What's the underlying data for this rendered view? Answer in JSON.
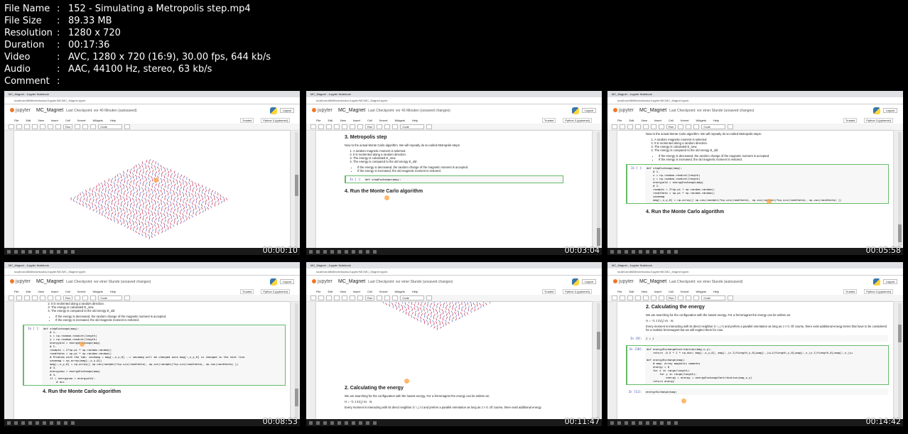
{
  "file_info": [
    {
      "key": "File Name",
      "value": "152 - Simulating a Metropolis step.mp4"
    },
    {
      "key": "File Size",
      "value": "89.33 MB"
    },
    {
      "key": "Resolution",
      "value": "1280 x 720"
    },
    {
      "key": "Duration",
      "value": "00:17:36"
    },
    {
      "key": "Video",
      "value": "AVC, 1280 x 720 (16:9), 30.00 fps, 644 kb/s"
    },
    {
      "key": "Audio",
      "value": "AAC, 44100 Hz, stereo, 63 kb/s"
    },
    {
      "key": "Comment",
      "value": ""
    }
  ],
  "colon": ":",
  "common": {
    "tab_title": "MC_Magnet - Jupyter Notebook",
    "url": "localhost:8888/notebooks/Jupyter/MC/MC_Magnet.ipynb",
    "logo_text": "jupyter",
    "notebook_name": "MC_Magnet",
    "logout": "Logout",
    "trusted": "Trusted",
    "kernel": "Python 3 (pykernel)",
    "menu": [
      "File",
      "Edit",
      "View",
      "Insert",
      "Cell",
      "Kernel",
      "Widgets",
      "Help"
    ],
    "run": "Run",
    "cell_type": "Code"
  },
  "thumbnails": [
    {
      "timestamp": "00:00:10",
      "checkpoint": "Last Checkpoint: vor 40 Minuten  (autosaved)"
    },
    {
      "timestamp": "00:03:04",
      "checkpoint": "Last Checkpoint: vor 43 Minuten  (unsaved changes)"
    },
    {
      "timestamp": "00:05:58",
      "checkpoint": "Last Checkpoint: vor einer Stunde  (unsaved changes)"
    },
    {
      "timestamp": "00:08:53",
      "checkpoint": "Last Checkpoint: vor einer Stunde  (unsaved changes)"
    },
    {
      "timestamp": "00:11:47",
      "checkpoint": "Last Checkpoint: vor einer Stunde  (unsaved changes)"
    },
    {
      "timestamp": "00:14:42",
      "checkpoint": "Last Checkpoint: vor einer Stunde  (autosaved)"
    }
  ],
  "nb": {
    "h_metropolis": "3. Metropolis step",
    "intro": "Now to the actual Monte Carlo algorithm. We will repeatly do so-called Metropolis steps:",
    "steps": [
      "A random magnetic moment is selected.",
      "It is reoriented along a random direction.",
      "The energy is calculated E_new.",
      "The energy is compared to the old energy E_old"
    ],
    "bullets": [
      "If the energy is decreased, the random change of the magnetic moment is accepted.",
      "If the energy is increased, the old magnetic moment is restored."
    ],
    "prompt_empty": "In [ ]:",
    "code_def": "def stepExchange(mag):",
    "code_t3": "def stepExchange(mag):\n    # 1.\n    x = np.random.randint(length)\n    y = np.random.randint(length)\n    energyold = energyExchange(mag)\n    # 2.\n    randphi = 2*np.pi * np.random.random()\n    randtheta = np.pi * np.random.random()\n    savemag\n    mag[:,x,y,0] = np.array([ np.cos(randphi)*np.sin(randtheta), np.sin(randphi)*np.sin(randtheta), np.cos(randtheta) ])",
    "code_t4": "def stepExchange(mag):\n    # 1.\n    x = np.random.randint(length)\n    y = np.random.randint(length)\n    energyold = energyExchange(mag)\n    # 2.\n    randphi = 2*np.pi * np.random.random()\n    randtheta = np.pi * np.random.random()\n    # Problem with the tab: savemag = mag[:,x,y,0] --> savemag will be changed once mag[:,x,y,0] is changed in the next line\n    savemag = np.array(mag[:,x,y,0])\n    mag[:,x,y,0] = np.array([ np.cos(randphi)*np.sin(randtheta), np.sin(randphi)*np.sin(randtheta), np.cos(randtheta) ])\n    # 3.\n    energynew = energyExchange(mag)\n    # 4.\n    if ( energynew < energyold):\n        # acc",
    "h_run": "4. Run the Monte Carlo algorithm",
    "h_energy": "2. Calculating the energy",
    "energy_intro": "We are searching for the configuration with the lowest energy. For a ferromagnet the energy can be written as:",
    "formula": "H = -½ J Σ⟨i,j⟩ mᵢ · mⱼ",
    "energy_text": "Every moment is interacting with its direct neighbor (< i, j >) and prefers a parallel orientation as long as J > 0. Of course, there exist additional energy terms that have to be considered for a realistic ferromagnet but we will neglect them for now.",
    "energy_text_short": "Every moment is interacting with its direct neighbor (< i, j >) and prefers a parallel orientation as long as J > 0. Of course, there exist additional energy",
    "prompt_9": "In [9]:",
    "code_9": "J = 1",
    "prompt_10": "In [10]:",
    "code_10": "def energyExchangeContribution(mag,x,y):\n    return -0.5 * J * np.dot( mag[:,x,y,0], mag[:,(x-1)%length,y,0]+mag[:,(x+1)%length,y,0]+mag[:,x,(y-1)%length,0]+mag[:,x,(y+\n\ndef energyExchange(mag):\n    # mag: Array magnetic moments\n    energy = 0\n    for x in range(length):\n        for y in range(length):\n            energy = energy + energyExchangeContribution(mag,x,y)\n    return energy",
    "prompt_11": "In [11]:",
    "code_11": "energyExchange(mag)"
  }
}
